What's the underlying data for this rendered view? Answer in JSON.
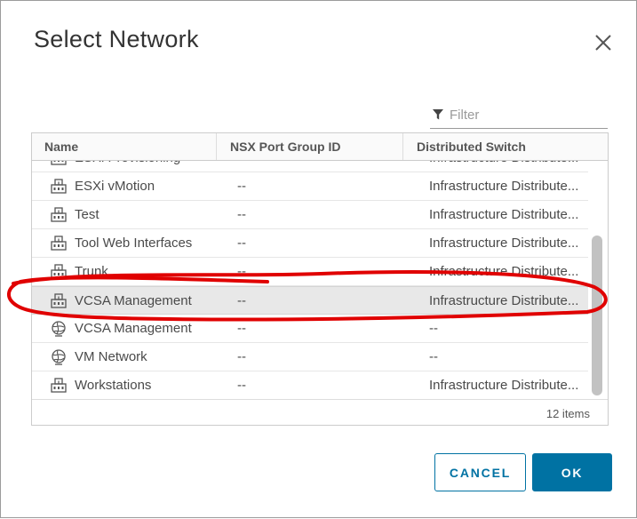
{
  "dialog": {
    "title": "Select Network",
    "close_icon": "close-icon"
  },
  "filter": {
    "placeholder": "Filter",
    "icon": "funnel-icon"
  },
  "table": {
    "columns": [
      "Name",
      "NSX Port Group ID",
      "Distributed Switch"
    ],
    "rows": [
      {
        "name": "ESXi Provisioning",
        "nsx": "--",
        "switch": "Infrastructure Distribute...",
        "icon": "distributed-portgroup-icon",
        "selected": false
      },
      {
        "name": "ESXi vMotion",
        "nsx": "--",
        "switch": "Infrastructure Distribute...",
        "icon": "distributed-portgroup-icon",
        "selected": false
      },
      {
        "name": "Test",
        "nsx": "--",
        "switch": "Infrastructure Distribute...",
        "icon": "distributed-portgroup-icon",
        "selected": false
      },
      {
        "name": "Tool Web Interfaces",
        "nsx": "--",
        "switch": "Infrastructure Distribute...",
        "icon": "distributed-portgroup-icon",
        "selected": false
      },
      {
        "name": "Trunk",
        "nsx": "--",
        "switch": "Infrastructure Distribute...",
        "icon": "distributed-portgroup-icon",
        "selected": false
      },
      {
        "name": "VCSA Management",
        "nsx": "--",
        "switch": "Infrastructure Distribute...",
        "icon": "distributed-portgroup-icon",
        "selected": true
      },
      {
        "name": "VCSA Management",
        "nsx": "--",
        "switch": "--",
        "icon": "standard-network-globe-icon",
        "selected": false
      },
      {
        "name": "VM Network",
        "nsx": "--",
        "switch": "--",
        "icon": "standard-network-globe-icon",
        "selected": false
      },
      {
        "name": "Workstations",
        "nsx": "--",
        "switch": "Infrastructure Distribute...",
        "icon": "distributed-portgroup-icon",
        "selected": false
      }
    ],
    "footer": "12 items"
  },
  "buttons": {
    "cancel": "CANCEL",
    "ok": "OK"
  },
  "colors": {
    "primary": "#0072a3",
    "selected_row": "#e8e8e8",
    "annotation": "#e00000"
  }
}
